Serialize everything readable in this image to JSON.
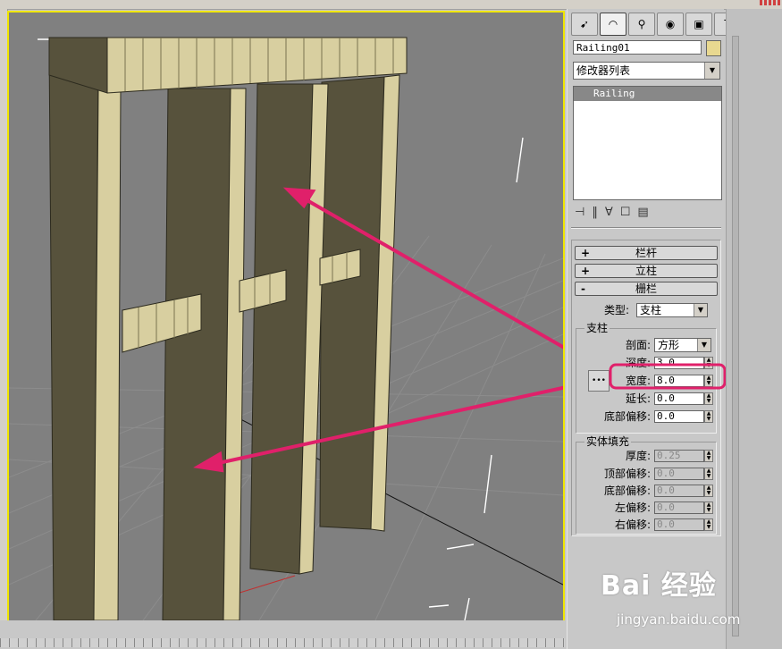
{
  "object_name": "Railing01",
  "modifier_list": "修改器列表",
  "modifier_stack": [
    "Railing"
  ],
  "tabs": [
    "create-icon",
    "modify-icon",
    "hierarchy-icon",
    "motion-icon",
    "display-icon",
    "utilities-icon"
  ],
  "rollouts": {
    "railing": "栏杆",
    "posts": "立柱",
    "fencing": "栅栏"
  },
  "fencing": {
    "type_label": "类型:",
    "type_value": "支柱",
    "support_group": "支柱",
    "profile_label": "剖面:",
    "profile_value": "方形",
    "depth_label": "深度:",
    "depth_value": "3.0",
    "width_label": "宽度:",
    "width_value": "8.0",
    "extension_label": "延长:",
    "extension_value": "0.0",
    "bottom_offset_label": "底部偏移:",
    "bottom_offset_value": "0.0"
  },
  "solid_fill": {
    "group": "实体填充",
    "thickness_label": "厚度:",
    "thickness_value": "0.25",
    "top_offset_label": "顶部偏移:",
    "top_offset_value": "0.0",
    "bottom_offset_label": "底部偏移:",
    "bottom_offset_value": "0.0",
    "left_offset_label": "左偏移:",
    "left_offset_value": "0.0",
    "right_offset_label": "右偏移:",
    "right_offset_value": "0.0"
  },
  "colors": {
    "viewport_border": "#f0e600",
    "highlight": "#e0206a",
    "post_face": "#57523c",
    "post_edge": "#d8cfa0"
  },
  "watermark": {
    "logo": "Bai 经验",
    "url": "jingyan.baidu.com"
  }
}
